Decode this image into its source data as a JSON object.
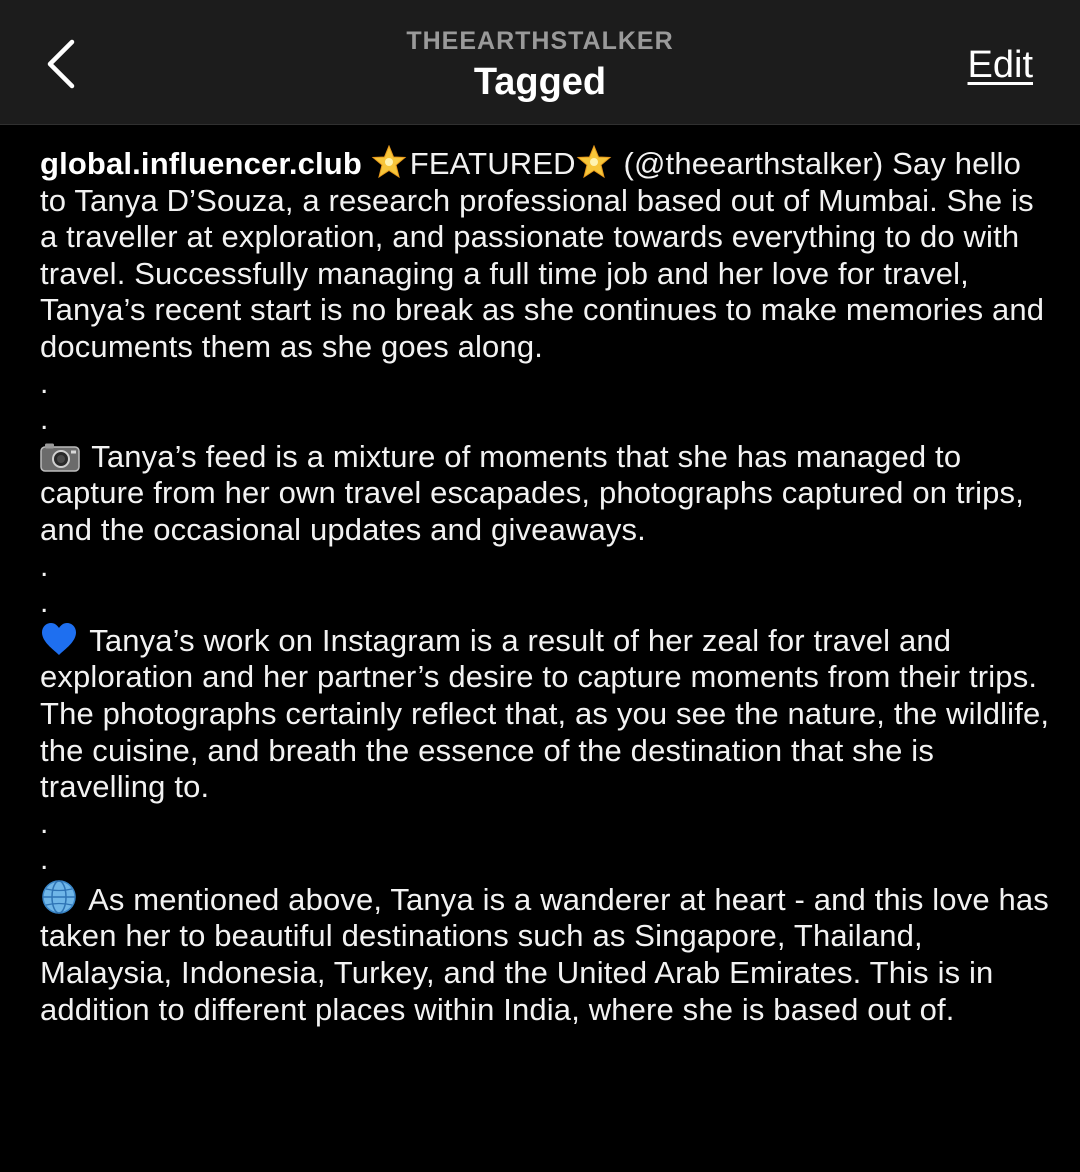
{
  "header": {
    "username": "THEEARTHSTALKER",
    "title": "Tagged",
    "edit_label": "Edit",
    "back_icon": "chevron-left-icon"
  },
  "caption": {
    "author": "global.influencer.club",
    "featured_label": "FEATURED",
    "intro_text": "(@theearthstalker) Say hello to Tanya D’Souza, a research professional based out of Mumbai. She is a traveller at exploration, and passionate towards everything to do with travel. Successfully managing a full time job and her love for travel, Tanya’s recent start is no break as she continues to make memories and documents them as she goes along.",
    "separator": ".",
    "paragraph_feed": "Tanya’s feed is a mixture of moments that she has managed to capture from her own travel escapades, photographs captured on trips, and the occasional updates and giveaways.",
    "paragraph_work": "Tanya’s work on Instagram is a result of her zeal for travel and exploration and her partner’s desire to capture moments from their trips. The photographs certainly reflect that, as you see the nature, the wildlife, the cuisine, and breath the essence of the destination that she is travelling to.",
    "paragraph_travel": "As mentioned above, Tanya is a wanderer at heart - and this love has taken her to beautiful destinations such as Singapore, Thailand, Malaysia, Indonesia, Turkey, and the United Arab Emirates. This is in addition to different places within India, where she is based out of.",
    "icons": [
      "glowing-star-icon",
      "camera-icon",
      "blue-heart-icon",
      "globe-icon"
    ]
  },
  "colors": {
    "background": "#000000",
    "header_background": "#1c1c1c",
    "username_gray": "#9a9a9a",
    "text": "#f2f2f2",
    "heart_blue": "#1e6ff0"
  }
}
